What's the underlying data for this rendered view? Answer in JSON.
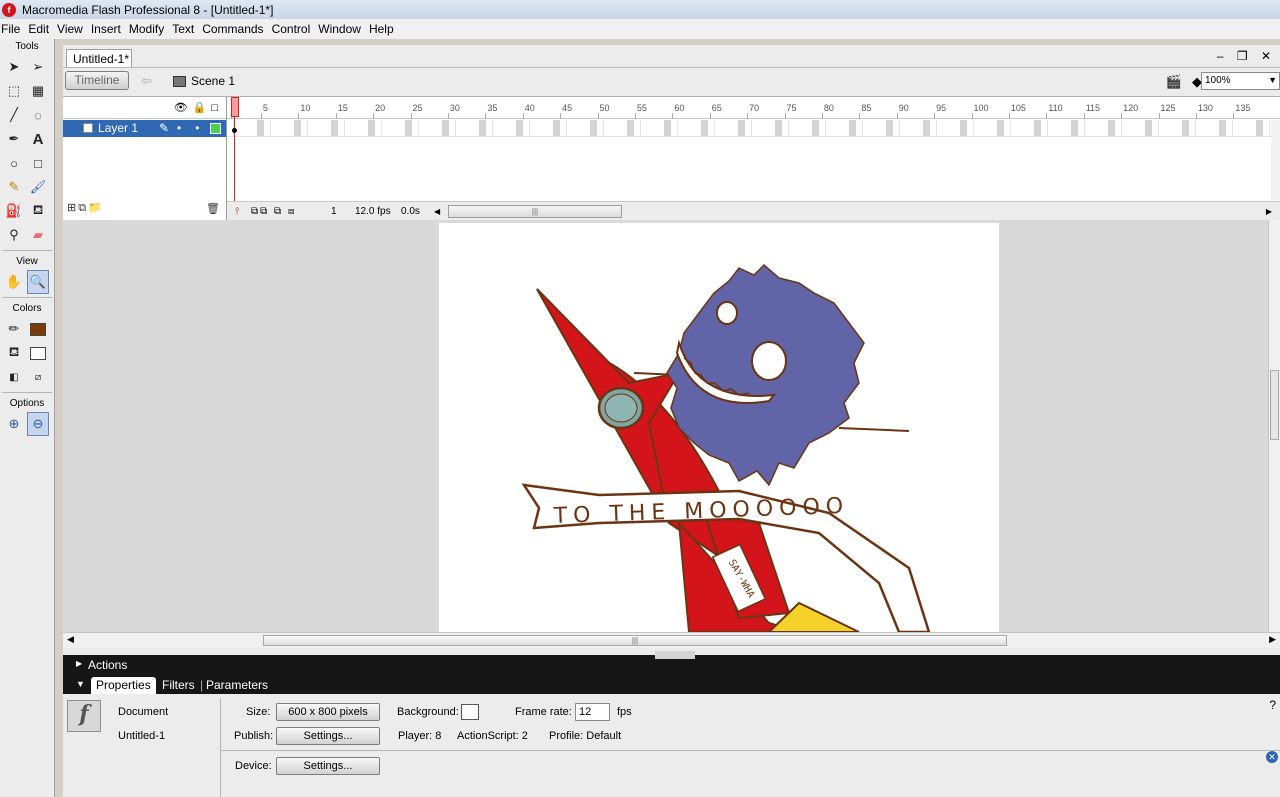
{
  "window": {
    "title": "Macromedia Flash Professional 8 - [Untitled-1*]",
    "app_icon": "f"
  },
  "menu": [
    "File",
    "Edit",
    "View",
    "Insert",
    "Modify",
    "Text",
    "Commands",
    "Control",
    "Window",
    "Help"
  ],
  "tools": {
    "title": "Tools",
    "view_label": "View",
    "colors_label": "Colors",
    "options_label": "Options",
    "stroke_color": "#7a3c08",
    "fill_color": "#ffffff"
  },
  "document": {
    "tab": "Untitled-1*",
    "window_controls": "– ❐ ✕",
    "timeline_button": "Timeline",
    "scene": "Scene 1",
    "zoom": "100%"
  },
  "timeline": {
    "layer_name": "Layer 1",
    "layer_color": "#4fd04f",
    "ruler_ticks": [
      "1",
      "5",
      "10",
      "15",
      "20",
      "25",
      "30",
      "35",
      "40",
      "45",
      "50",
      "55",
      "60",
      "65",
      "70",
      "75",
      "80",
      "85",
      "90",
      "95",
      "100",
      "105",
      "110",
      "115",
      "120",
      "125",
      "130",
      "135"
    ],
    "current_frame": "1",
    "frame_rate": "12.0 fps",
    "elapsed": "0.0s"
  },
  "artwork": {
    "banner_text": "TO THE MOOOOOO",
    "rocket_label": "SAY-WHA",
    "colors": {
      "outline": "#6b3412",
      "rocket": "#d3151b",
      "monster": "#6164a7",
      "window": "#7fa6a3",
      "flame": "#f4d22a"
    }
  },
  "panels": {
    "actions": "Actions",
    "tabs": [
      "Properties",
      "Filters",
      "Parameters"
    ],
    "doc_type": "Document",
    "doc_name": "Untitled-1",
    "size_label": "Size:",
    "size_value": "600 x 800 pixels",
    "background_label": "Background:",
    "frame_rate_label": "Frame rate:",
    "frame_rate_value": "12",
    "fps_unit": "fps",
    "publish_label": "Publish:",
    "settings_button": "Settings...",
    "player": "Player: 8",
    "actionscript": "ActionScript: 2",
    "profile": "Profile: Default",
    "device_label": "Device:",
    "device_settings_button": "Settings..."
  }
}
